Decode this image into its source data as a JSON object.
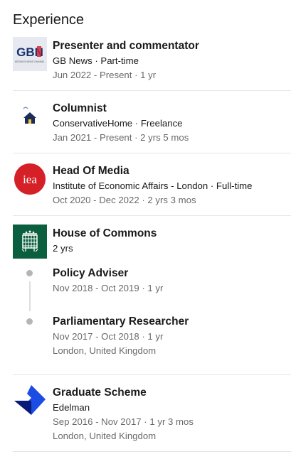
{
  "section": {
    "title": "Experience"
  },
  "entries": [
    {
      "title": "Presenter and commentator",
      "company": "GB News · Part-time",
      "dates": "Jun 2022 - Present · 1 yr",
      "logo_text": "GBN",
      "logo_tagline": "BRITAIN'S NEWS CHANNEL"
    },
    {
      "title": "Columnist",
      "company": "ConservativeHome · Freelance",
      "dates": "Jan 2021 - Present · 2 yrs 5 mos"
    },
    {
      "title": "Head Of Media",
      "company": "Institute of Economic Affairs - London · Full-time",
      "dates": "Oct 2020 - Dec 2022 · 2 yrs 3 mos",
      "logo_text": "iea"
    },
    {
      "title": "House of Commons",
      "duration": "2 yrs",
      "roles": [
        {
          "title": "Policy Adviser",
          "dates": "Nov 2018 - Oct 2019 · 1 yr"
        },
        {
          "title": "Parliamentary Researcher",
          "dates": "Nov 2017 - Oct 2018 · 1 yr",
          "location": "London, United Kingdom"
        }
      ]
    },
    {
      "title": "Graduate Scheme",
      "company": "Edelman",
      "dates": "Sep 2016 - Nov 2017 · 1 yr 3 mos",
      "location": "London, United Kingdom"
    }
  ],
  "colors": {
    "gbn_blue": "#1a2f6e",
    "gbn_red": "#d3242c",
    "iea_red": "#d62027",
    "commons_green": "#0b5f3f",
    "edelman_blue": "#1b4de4",
    "edelman_navy": "#0a1a7a"
  }
}
